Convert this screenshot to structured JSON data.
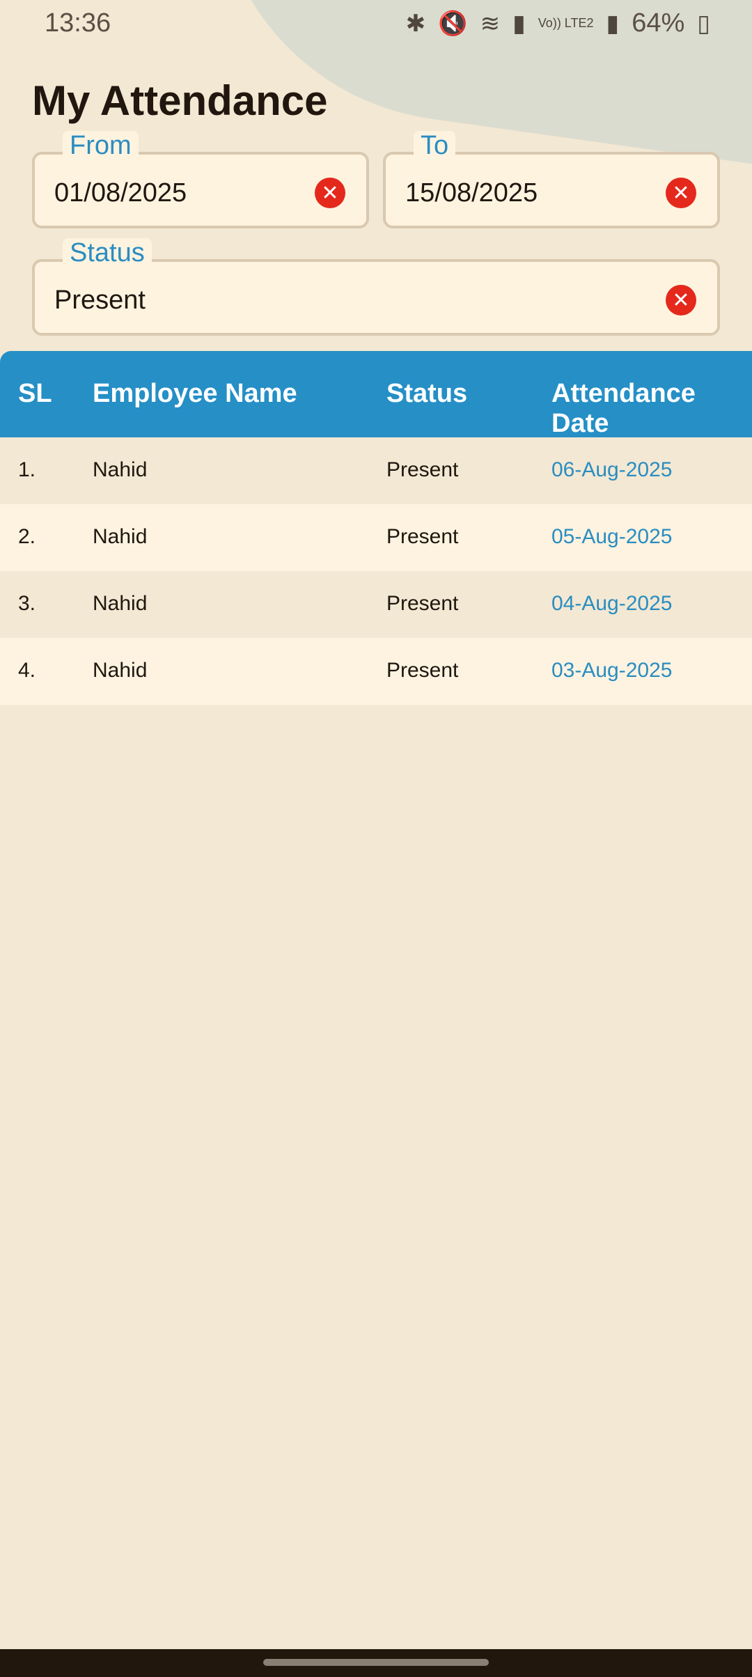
{
  "status_bar": {
    "time": "13:36",
    "battery": "64%",
    "icons": [
      "bluetooth-icon",
      "mute-icon",
      "wifi-icon",
      "signal-icon",
      "volte-icon",
      "signal-icon",
      "battery-icon"
    ],
    "volte_label": "Vo)) LTE2"
  },
  "page": {
    "title": "My Attendance"
  },
  "filters": {
    "from": {
      "label": "From",
      "value": "01/08/2025"
    },
    "to": {
      "label": "To",
      "value": "15/08/2025"
    },
    "status": {
      "label": "Status",
      "value": "Present"
    }
  },
  "table": {
    "headers": {
      "sl": "SL",
      "name": "Employee Name",
      "status": "Status",
      "date": "Attendance Date"
    },
    "rows": [
      {
        "sl": "1.",
        "name": "Nahid",
        "status": "Present",
        "date": "06-Aug-2025"
      },
      {
        "sl": "2.",
        "name": "Nahid",
        "status": "Present",
        "date": "05-Aug-2025"
      },
      {
        "sl": "3.",
        "name": "Nahid",
        "status": "Present",
        "date": "04-Aug-2025"
      },
      {
        "sl": "4.",
        "name": "Nahid",
        "status": "Present",
        "date": "03-Aug-2025"
      }
    ]
  },
  "colors": {
    "background": "#f3e8d3",
    "accent": "#258fc6",
    "clear_button": "#e5281c",
    "date_text": "#2a8dc2"
  }
}
